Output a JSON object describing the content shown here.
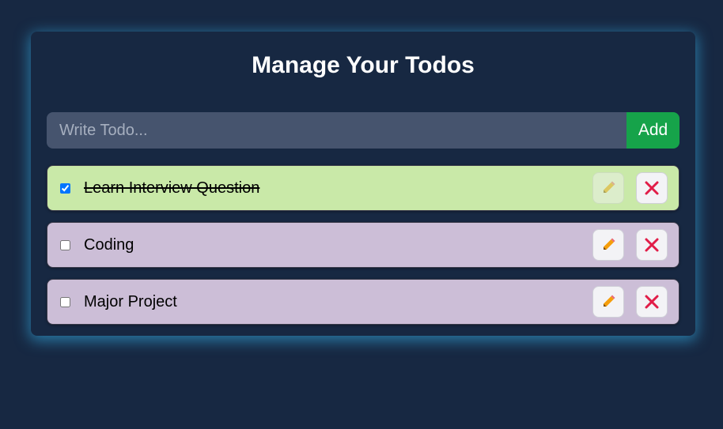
{
  "header": {
    "title": "Manage Your Todos"
  },
  "form": {
    "placeholder": "Write Todo...",
    "value": "",
    "add_label": "Add"
  },
  "colors": {
    "background": "#172842",
    "completed_row": "#c9e9a8",
    "pending_row": "#ccbed7",
    "add_button": "#16a34a",
    "edit_icon": "#f59e0b",
    "delete_icon": "#e11d48",
    "glow": "#38bdf8"
  },
  "todos": [
    {
      "text": "Learn Interview Question",
      "completed": true,
      "edit_icon": "pencil-icon",
      "delete_icon": "close-icon"
    },
    {
      "text": "Coding",
      "completed": false,
      "edit_icon": "pencil-icon",
      "delete_icon": "close-icon"
    },
    {
      "text": "Major Project",
      "completed": false,
      "edit_icon": "pencil-icon",
      "delete_icon": "close-icon"
    }
  ]
}
